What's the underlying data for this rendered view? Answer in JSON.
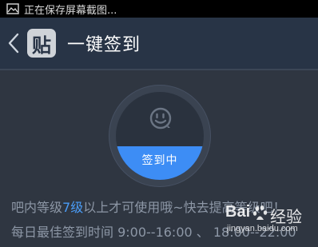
{
  "status_bar": {
    "notification_text": "正在保存屏幕截图..."
  },
  "nav": {
    "logo_text": "贴",
    "title": "一键签到"
  },
  "sign_in": {
    "button_label": "签到中",
    "progress": 0.38
  },
  "info": {
    "line1_before": "吧内等级",
    "line1_level": "7级",
    "line1_after": "以上才可使用哦~快去提高等级吧！",
    "line2": "每日最佳签到时间  9:00--16:00 、 18:00--22:00"
  },
  "watermark": {
    "brand": "Bai",
    "brand_cn": "经验",
    "url": "jingyan.baidu.com"
  },
  "colors": {
    "background": "#2f3641",
    "nav_background": "#283446",
    "accent_blue": "#3d8df5",
    "level_blue": "#4a9cf6",
    "info_text": "#8d97a6"
  }
}
